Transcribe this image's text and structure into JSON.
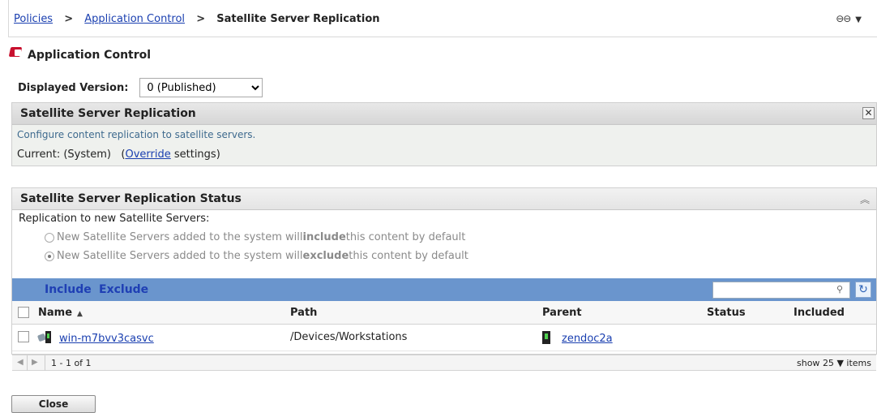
{
  "breadcrumb": {
    "items": [
      "Policies",
      "Application Control"
    ],
    "separator": ">",
    "current": "Satellite Server Replication"
  },
  "header": {
    "link_icon": "link-icon",
    "link_caret": "▼"
  },
  "policy": {
    "icon": "application-control-icon",
    "title": "Application Control"
  },
  "version": {
    "label": "Displayed Version:",
    "selected": "0 (Published)"
  },
  "replication_panel": {
    "title": "Satellite Server Replication",
    "close_glyph": "✕",
    "description": "Configure content replication to satellite servers.",
    "current_label": "Current:",
    "current_value": "(System)",
    "override_link": "Override",
    "override_suffix": "settings)",
    "override_prefix": "("
  },
  "status_panel": {
    "title": "Satellite Server Replication Status",
    "collapse_glyph": "≈",
    "replication_label": "Replication to new Satellite Servers:",
    "options": [
      {
        "pre": "New Satellite Servers added to the system will ",
        "bold": "include",
        "post": " this content by default",
        "selected": false
      },
      {
        "pre": "New Satellite Servers added to the system will ",
        "bold": "exclude",
        "post": " this content by default",
        "selected": true
      }
    ]
  },
  "toolbar": {
    "include_label": "Include",
    "exclude_label": "Exclude",
    "search_placeholder": "",
    "search_icon": "search-icon",
    "refresh_icon": "refresh-icon"
  },
  "table": {
    "columns": [
      "Name",
      "Path",
      "Parent",
      "Status",
      "Included"
    ],
    "sort_glyph": "▲",
    "rows": [
      {
        "name": "win-m7bvv3casvc",
        "path": "/Devices/Workstations",
        "parent": "zendoc2a",
        "status": "",
        "included": ""
      }
    ]
  },
  "pager": {
    "prev_glyph": "◀",
    "next_glyph": "▶",
    "range": "1 - 1 of 1",
    "show_label": "show",
    "page_size": "25",
    "page_size_caret": "▼",
    "items_label": "items"
  },
  "footer": {
    "close_label": "Close"
  }
}
